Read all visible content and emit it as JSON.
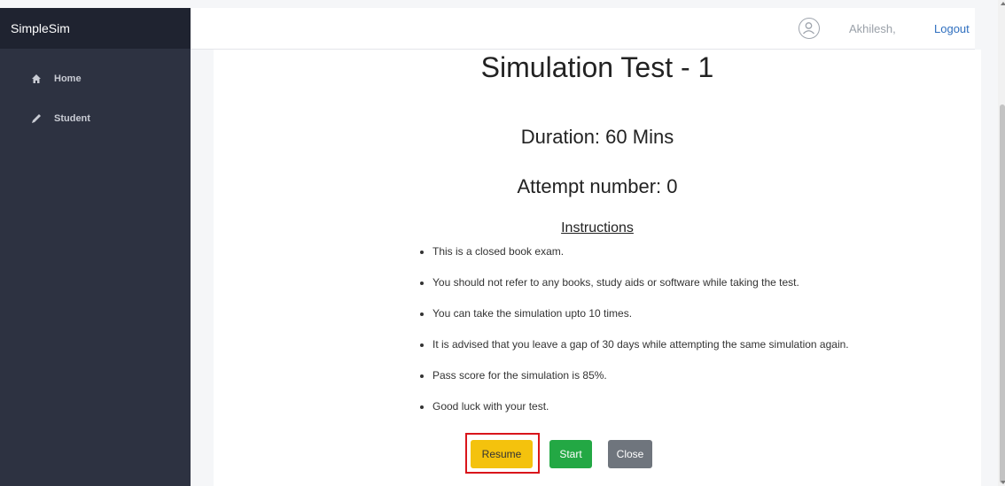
{
  "brand": "SimpleSim",
  "sidebar": {
    "items": [
      {
        "label": "Home",
        "icon": "home-icon"
      },
      {
        "label": "Student",
        "icon": "pencil-icon"
      }
    ]
  },
  "header": {
    "username": "Akhilesh,",
    "logout_label": "Logout"
  },
  "main": {
    "title": "Simulation Test - 1",
    "duration": "Duration: 60 Mins",
    "attempt": "Attempt number: 0",
    "instructions_heading": "Instructions",
    "instructions": [
      "This is a closed book exam.",
      "You should not refer to any books, study aids or software while taking the test.",
      "You can take the simulation upto 10 times.",
      "It is advised that you leave a gap of 30 days while attempting the same simulation again.",
      "Pass score for the simulation is 85%.",
      "Good luck with your test."
    ],
    "buttons": {
      "resume": "Resume",
      "start": "Start",
      "close": "Close"
    }
  },
  "colors": {
    "sidebar_bg": "#2d3241",
    "brand_bg": "#1f2330",
    "resume": "#f4c20d",
    "start": "#23a844",
    "close": "#6f757d",
    "highlight": "#d9151b",
    "logout_link": "#2f6fbf"
  }
}
